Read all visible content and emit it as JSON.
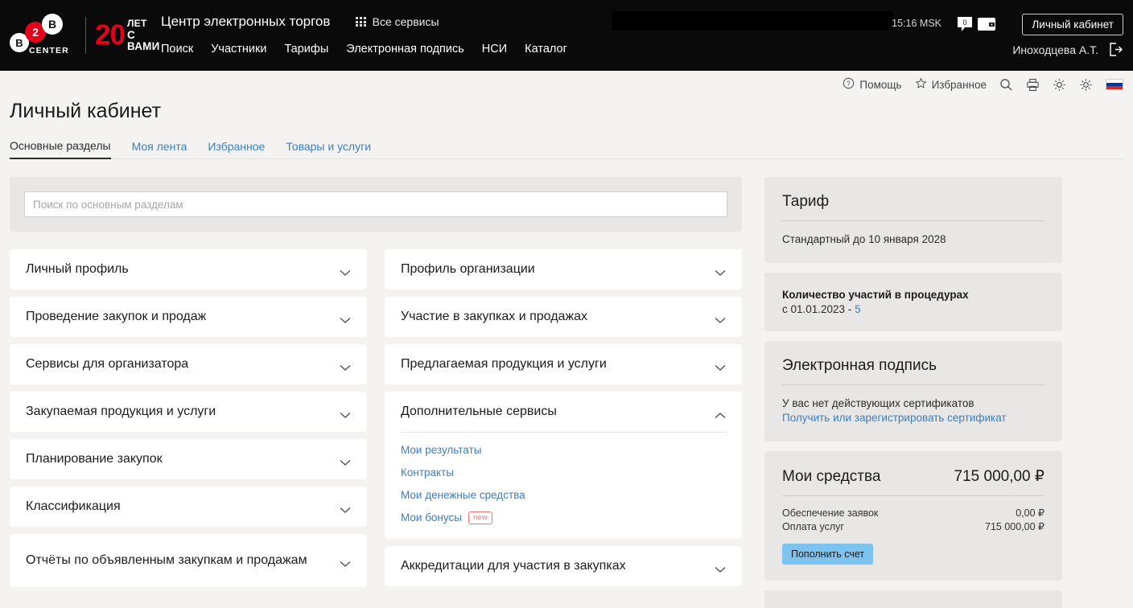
{
  "header": {
    "logo": {
      "circle_1": "B",
      "circle_2": "2",
      "circle_3": "B",
      "center_word": "CENTER",
      "anniversary_number": "20",
      "anniversary_line1": "ЛЕТ",
      "anniversary_line2": "С ВАМИ"
    },
    "site_title": "Центр электронных торгов",
    "all_services": "Все сервисы",
    "nav_links": [
      "Поиск",
      "Участники",
      "Тарифы",
      "Электронная подпись",
      "НСИ",
      "Каталог"
    ],
    "clock": "15:16 MSK",
    "messages_count": "0",
    "cabinet_button": "Личный кабинет",
    "user_name": "Иноходцева А.Т.",
    "icons": {
      "grid": "grid-icon",
      "message": "message-bubble-icon",
      "wallet": "wallet-icon",
      "logout": "logout-icon"
    }
  },
  "utilbar": {
    "help": "Помощь",
    "favorites": "Избранное",
    "icons": {
      "help": "question-circle-icon",
      "favorites": "star-icon",
      "search": "search-icon",
      "print": "printer-icon",
      "settings": "gear-icon",
      "brightness": "sun-icon",
      "language": "russian-flag-icon"
    }
  },
  "page": {
    "title": "Личный кабинет",
    "tabs": [
      {
        "label": "Основные разделы",
        "active": true
      },
      {
        "label": "Моя лента",
        "active": false
      },
      {
        "label": "Избранное",
        "active": false
      },
      {
        "label": "Товары и услуги",
        "active": false
      }
    ]
  },
  "search": {
    "value": "",
    "placeholder": "Поиск по основным разделам"
  },
  "sections": {
    "left": [
      {
        "title": "Личный профиль",
        "expanded": false
      },
      {
        "title": "Проведение закупок и продаж",
        "expanded": false
      },
      {
        "title": "Сервисы для организатора",
        "expanded": false
      },
      {
        "title": "Закупаемая продукция и услуги",
        "expanded": false
      },
      {
        "title": "Планирование закупок",
        "expanded": false
      },
      {
        "title": "Классификация",
        "expanded": false
      },
      {
        "title": "Отчёты по объявленным закупкам и продажам",
        "expanded": false
      }
    ],
    "right": [
      {
        "title": "Профиль организации",
        "expanded": false
      },
      {
        "title": "Участие в закупках и продажах",
        "expanded": false
      },
      {
        "title": "Предлагаемая продукция и услуги",
        "expanded": false
      },
      {
        "title": "Дополнительные сервисы",
        "expanded": true,
        "links": [
          {
            "label": "Мои результаты",
            "badge": ""
          },
          {
            "label": "Контракты",
            "badge": ""
          },
          {
            "label": "Мои денежные средства",
            "badge": ""
          },
          {
            "label": "Мои бонусы",
            "badge": "new"
          }
        ]
      },
      {
        "title": "Аккредитации для участия в закупках",
        "expanded": false
      }
    ]
  },
  "sidebar": {
    "tariff": {
      "title": "Тариф",
      "text": "Стандартный до 10 января 2028"
    },
    "participations": {
      "title": "Количество участий в процедурах",
      "period_label": "с 01.01.2023 - ",
      "count": "5"
    },
    "signature": {
      "title": "Электронная подпись",
      "status": "У вас нет действующих сертификатов",
      "link": "Получить или зарегистрировать сертификат"
    },
    "funds": {
      "title": "Мои средства",
      "total": "715 000,00 ₽",
      "rows": [
        {
          "label": "Обеспечение заявок",
          "value": "0,00 ₽"
        },
        {
          "label": "Оплата услуг",
          "value": "715 000,00 ₽"
        }
      ],
      "button": "Пополнить счет"
    }
  },
  "colors": {
    "header_bg": "#0a0a0a",
    "page_bg": "#f4f3f2",
    "card_bg": "#ffffff",
    "side_card_bg": "#e8e7e6",
    "link": "#3a7fc1",
    "accent_red": "#e2001a",
    "badge_new": "#f0746a",
    "button_blue": "#7cc3f0"
  }
}
